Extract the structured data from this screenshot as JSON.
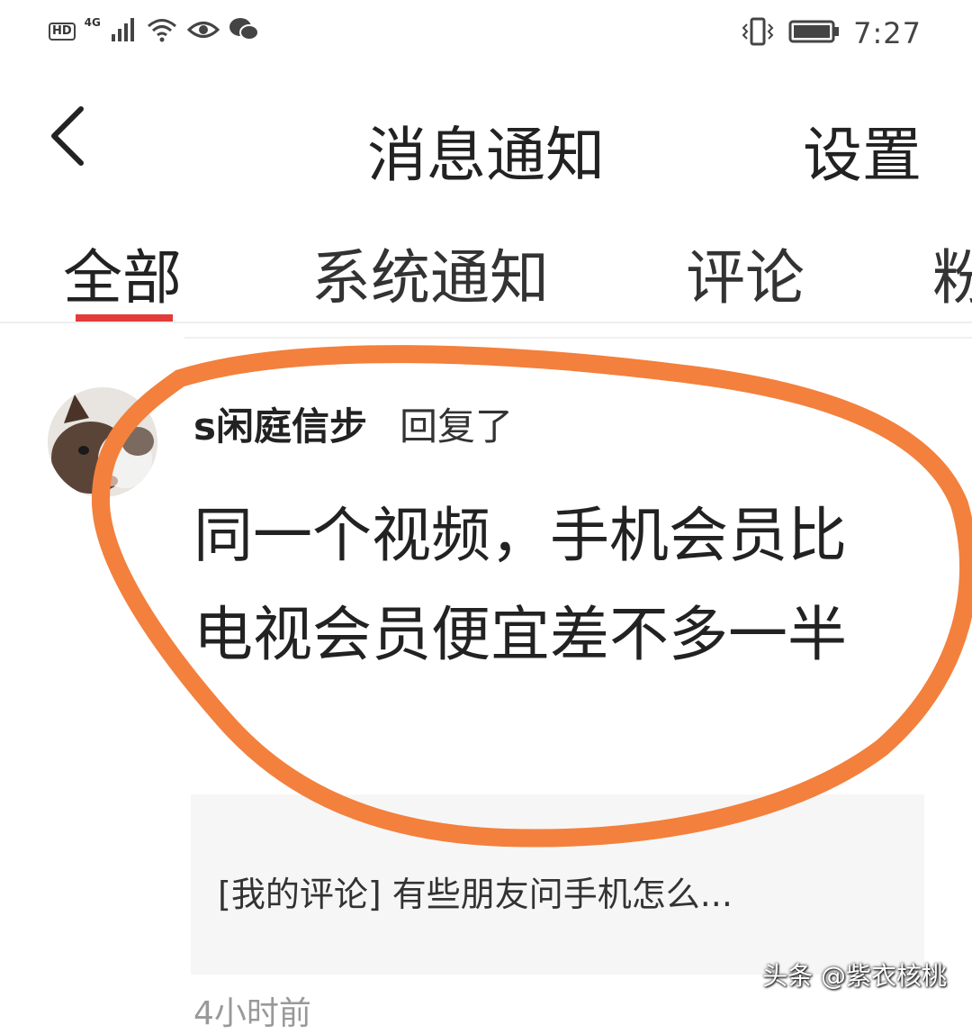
{
  "status_bar": {
    "left_badge": "HD",
    "network": "4G",
    "time": "7:27"
  },
  "header": {
    "title": "消息通知",
    "settings_label": "设置"
  },
  "tabs": [
    {
      "label": "全部",
      "active": true
    },
    {
      "label": "系统通知",
      "active": false
    },
    {
      "label": "评论",
      "active": false
    },
    {
      "label": "粉",
      "active": false
    }
  ],
  "notification": {
    "username": "s闲庭信步",
    "action": "回复了",
    "reply_text": "同一个视频，手机会员比电视会员便宜差不多一半",
    "quoted_comment": "[我的评论] 有些朋友问手机怎么...",
    "time_ago": "4小时前"
  },
  "watermark": "头条 @紫衣核桃",
  "colors": {
    "tab_indicator": "#e33a3a",
    "annotation_circle": "#f3803d"
  }
}
